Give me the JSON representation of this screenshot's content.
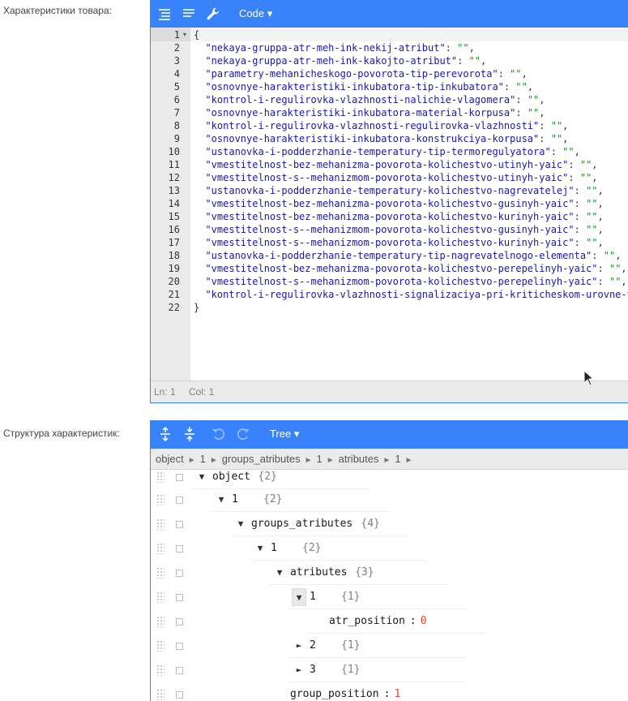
{
  "labels": {
    "product_characteristics": "Характеристики товара:",
    "characteristics_structure": "Структура характеристик:"
  },
  "code_editor": {
    "toolbar": {
      "format_icon": "format-json-icon",
      "compact_icon": "compact-json-icon",
      "repair_icon": "wrench-icon",
      "mode_label": "Code ▾"
    },
    "lines": [
      {
        "num": "1",
        "prefix": "",
        "key": "",
        "value": "",
        "text": "{",
        "fold": "▾"
      },
      {
        "num": "2",
        "key": "\"nekaya-gruppa-atr-meh-ink-nekij-atribut\"",
        "value": "\"\"",
        "suffix": ","
      },
      {
        "num": "3",
        "key": "\"nekaya-gruppa-atr-meh-ink-kakojto-atribut\"",
        "value": "\"\"",
        "suffix": ","
      },
      {
        "num": "4",
        "key": "\"parametry-mehanicheskogo-povorota-tip-perevorota\"",
        "value": "\"\"",
        "suffix": ","
      },
      {
        "num": "5",
        "key": "\"osnovnye-harakteristiki-inkubatora-tip-inkubatora\"",
        "value": "\"\"",
        "suffix": ","
      },
      {
        "num": "6",
        "key": "\"kontrol-i-regulirovka-vlazhnosti-nalichie-vlagomera\"",
        "value": "\"\"",
        "suffix": ","
      },
      {
        "num": "7",
        "key": "\"osnovnye-harakteristiki-inkubatora-material-korpusa\"",
        "value": "\"\"",
        "suffix": ","
      },
      {
        "num": "8",
        "key": "\"kontrol-i-regulirovka-vlazhnosti-regulirovka-vlazhnosti\"",
        "value": "\"\"",
        "suffix": ","
      },
      {
        "num": "9",
        "key": "\"osnovnye-harakteristiki-inkubatora-konstrukciya-korpusa\"",
        "value": "\"\"",
        "suffix": ","
      },
      {
        "num": "10",
        "key": "\"ustanovka-i-podderzhanie-temperatury-tip-termoregulyatora\"",
        "value": "\"\"",
        "suffix": ","
      },
      {
        "num": "11",
        "key": "\"vmestitelnost-bez-mehanizma-povorota-kolichestvo-utinyh-yaic\"",
        "value": "\"\"",
        "suffix": ","
      },
      {
        "num": "12",
        "key": "\"vmestitelnost-s--mehanizmom-povorota-kolichestvo-utinyh-yaic\"",
        "value": "\"\"",
        "suffix": ","
      },
      {
        "num": "13",
        "key": "\"ustanovka-i-podderzhanie-temperatury-kolichestvo-nagrevatelej\"",
        "value": "\"\"",
        "suffix": ","
      },
      {
        "num": "14",
        "key": "\"vmestitelnost-bez-mehanizma-povorota-kolichestvo-gusinyh-yaic\"",
        "value": "\"\"",
        "suffix": ","
      },
      {
        "num": "15",
        "key": "\"vmestitelnost-bez-mehanizma-povorota-kolichestvo-kurinyh-yaic\"",
        "value": "\"\"",
        "suffix": ","
      },
      {
        "num": "16",
        "key": "\"vmestitelnost-s--mehanizmom-povorota-kolichestvo-gusinyh-yaic\"",
        "value": "\"\"",
        "suffix": ","
      },
      {
        "num": "17",
        "key": "\"vmestitelnost-s--mehanizmom-povorota-kolichestvo-kurinyh-yaic\"",
        "value": "\"\"",
        "suffix": ","
      },
      {
        "num": "18",
        "key": "\"ustanovka-i-podderzhanie-temperatury-tip-nagrevatelnogo-elementa\"",
        "value": "\"\"",
        "suffix": ","
      },
      {
        "num": "19",
        "key": "\"vmestitelnost-bez-mehanizma-povorota-kolichestvo-perepelinyh-yaic\"",
        "value": "\"\"",
        "suffix": ","
      },
      {
        "num": "20",
        "key": "\"vmestitelnost-s--mehanizmom-povorota-kolichestvo-perepelinyh-yaic\"",
        "value": "\"\"",
        "suffix": ","
      },
      {
        "num": "21",
        "key": "\"kontrol-i-regulirovka-vlazhnosti-signalizaciya-pri-kriticheskom-urovne-vlazhnosti\"",
        "value": "\"\"",
        "suffix": ""
      },
      {
        "num": "22",
        "text": "}"
      }
    ],
    "status": {
      "ln": "Ln: 1",
      "col": "Col: 1"
    }
  },
  "tree_editor": {
    "toolbar": {
      "expand_all_icon": "expand-all-icon",
      "collapse_all_icon": "collapse-all-icon",
      "undo_icon": "undo-icon",
      "redo_icon": "redo-icon",
      "mode_label": "Tree ▾"
    },
    "breadcrumb": [
      "object",
      "1",
      "groups_atributes",
      "1",
      "atributes",
      "1"
    ],
    "breadcrumb_sep": "►",
    "rows": [
      {
        "expander": "▼",
        "field": "object",
        "meta": "{2}",
        "partial": true
      },
      {
        "expander": "▼",
        "field": "1",
        "meta": "{2}"
      },
      {
        "expander": "▼",
        "field": "groups_atributes",
        "meta": "{4}"
      },
      {
        "expander": "▼",
        "field": "1",
        "meta": "{2}"
      },
      {
        "expander": "▼",
        "field": "atributes",
        "meta": "{3}"
      },
      {
        "expander": "▼",
        "field": "1",
        "meta": "{1}",
        "hover": true
      },
      {
        "expander": "",
        "field": "atr_position",
        "sep": ":",
        "number": "0"
      },
      {
        "expander": "►",
        "field": "2",
        "meta": "{1}"
      },
      {
        "expander": "►",
        "field": "3",
        "meta": "{1}"
      },
      {
        "expander": "",
        "field": "group_position",
        "sep": ":",
        "number": "1"
      }
    ]
  },
  "colors": {
    "accent": "#3883fa",
    "key": "#1a1aa6",
    "string": "#1a8f1a",
    "number": "#ee422e"
  }
}
